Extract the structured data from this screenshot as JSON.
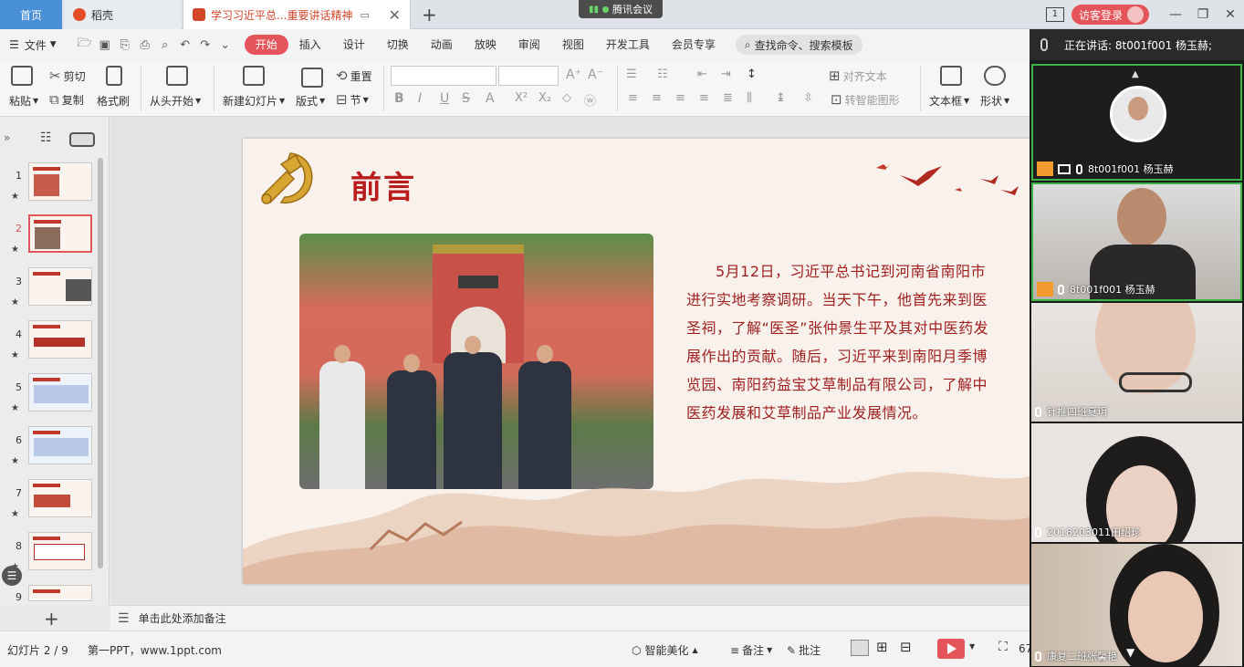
{
  "tabs": {
    "home": "首页",
    "daoke": "稻壳",
    "doc": "学习习近平总...重要讲话精神"
  },
  "meeting_badge": "腾讯会议",
  "titlebar": {
    "page_indicator": "1",
    "login": "访客登录"
  },
  "menu": {
    "file": "文件",
    "items": [
      "开始",
      "插入",
      "设计",
      "切换",
      "动画",
      "放映",
      "审阅",
      "视图",
      "开发工具",
      "会员专享"
    ],
    "search": "查找命令、搜索模板"
  },
  "ribbon": {
    "paste": "粘贴",
    "cut": "剪切",
    "copy": "复制",
    "format_painter": "格式刷",
    "from_start": "从头开始",
    "new_slide": "新建幻灯片",
    "layout": "版式",
    "reset": "重置",
    "section": "节",
    "align_text": "对齐文本",
    "smart_shape": "转智能图形",
    "textbox": "文本框",
    "shape": "形状"
  },
  "thumbnails": [
    {
      "num": "1"
    },
    {
      "num": "2"
    },
    {
      "num": "3"
    },
    {
      "num": "4"
    },
    {
      "num": "5"
    },
    {
      "num": "6"
    },
    {
      "num": "7"
    },
    {
      "num": "8"
    },
    {
      "num": "9"
    }
  ],
  "slide": {
    "title": "前言",
    "body": "5月12日，习近平总书记到河南省南阳市进行实地考察调研。当天下午，他首先来到医圣祠，了解“医圣”张仲景生平及其对中医药发展作出的贡献。随后，习近平来到南阳月季博览园、南阳药益宝艾草制品有限公司，了解中医药发展和艾草制品产业发展情况。"
  },
  "notes_placeholder": "单击此处添加备注",
  "status": {
    "slide_count": "幻灯片 2 / 9",
    "template": "第一PPT，www.1ppt.com",
    "beautify": "智能美化",
    "notes": "备注",
    "comments": "批注",
    "zoom": "67"
  },
  "meeting": {
    "speaking": "正在讲话: 8t001f001 杨玉赫;",
    "participants": [
      {
        "name": "8t001f001 杨玉赫"
      },
      {
        "name": "8t001f001 杨玉赫"
      },
      {
        "name": "针推四班夏玥"
      },
      {
        "name": "2018203011田绍珍"
      },
      {
        "name": "康复二班张馨艳"
      }
    ]
  }
}
